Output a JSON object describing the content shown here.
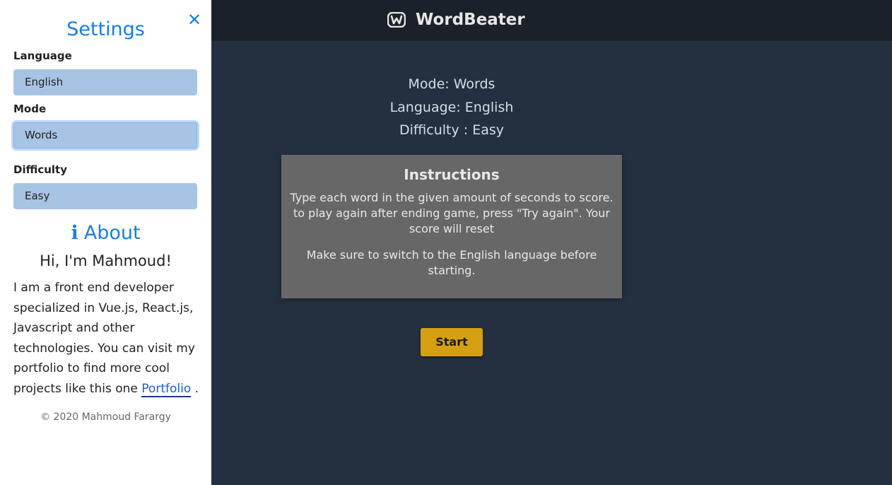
{
  "sidebar": {
    "title": "Settings",
    "close_glyph": "✕",
    "language": {
      "label": "Language",
      "value": "English"
    },
    "mode": {
      "label": "Mode",
      "value": "Words"
    },
    "difficulty": {
      "label": "Difficulty",
      "value": "Easy"
    },
    "about": {
      "icon": "info-icon",
      "icon_glyph": "i",
      "title": "About",
      "greeting": "Hi, I'm Mahmoud!",
      "text": "I am a front end developer specialized in Vue.js, React.js, Javascript and other technologies. You can visit my portfolio to find more cool projects like this one",
      "link_label": "Portfolio",
      "after_link": "."
    },
    "copyright": "© 2020 Mahmoud Farargy"
  },
  "navbar": {
    "brand": "WordBeater",
    "logo_icon": "w-logo-icon"
  },
  "game": {
    "mode_line": "Mode: Words",
    "language_line": "Language: English",
    "difficulty_line": "Difficulty : Easy",
    "instructions": {
      "title": "Instructions",
      "para1": "Type each word in the given amount of seconds to score. to play again after ending game, press \"Try again\". Your score will reset",
      "para2": "Make sure to switch to the English language before starting."
    },
    "start_label": "Start"
  },
  "colors": {
    "accent": "#1a7fe0",
    "select_bg": "#a8c4e4",
    "main_bg": "#242f40",
    "navbar_bg": "#1b212b",
    "start_button": "#d4a012",
    "instructions_bg": "#676767"
  }
}
